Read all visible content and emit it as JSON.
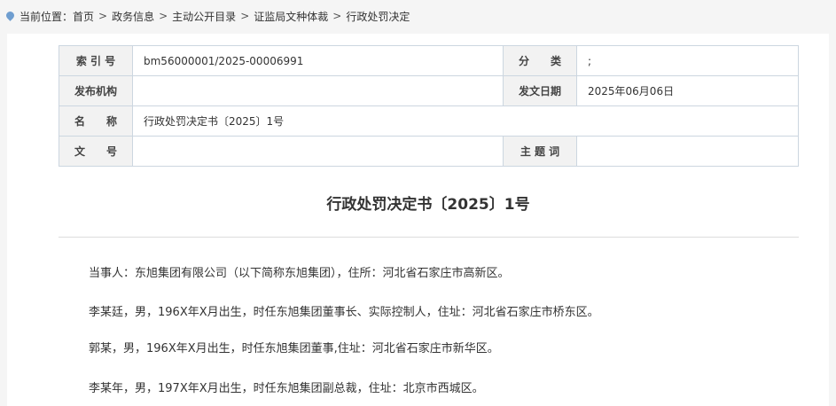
{
  "breadcrumb": {
    "prefix": "当前位置：",
    "items": [
      "首页",
      "政务信息",
      "主动公开目录",
      "证监局文种体裁",
      "行政处罚决定"
    ],
    "sep": ">"
  },
  "meta": {
    "index_label": "索 引 号",
    "index_value": "bm56000001/2025-00006991",
    "category_label": "分　　类",
    "category_value": ";",
    "publisher_label": "发布机构",
    "publisher_value": "",
    "date_label": "发文日期",
    "date_value": "2025年06月06日",
    "name_label": "名　　称",
    "name_value": "行政处罚决定书〔2025〕1号",
    "docno_label": "文　　号",
    "docno_value": "",
    "keywords_label": "主 题 词",
    "keywords_value": ""
  },
  "title": "行政处罚决定书〔2025〕1号",
  "paragraphs": [
    "当事人：东旭集团有限公司（以下简称东旭集团），住所：河北省石家庄市高新区。",
    "李某廷，男，196X年X月出生，时任东旭集团董事长、实际控制人，住址：河北省石家庄市桥东区。",
    "郭某，男，196X年X月出生，时任东旭集团董事,住址：河北省石家庄市新华区。",
    "李某年，男，197X年X月出生，时任东旭集团副总裁，住址：北京市西城区。"
  ]
}
